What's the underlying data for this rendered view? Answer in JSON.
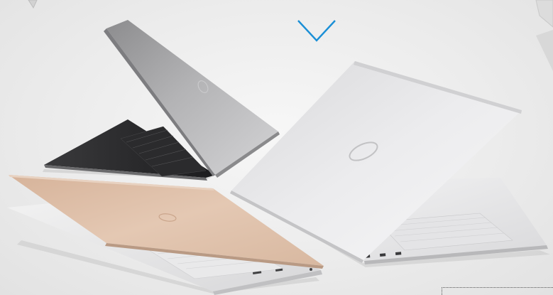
{
  "page": {
    "top_text": "",
    "scroll_icon": "chevron-down-icon",
    "accent_color": "#1a8fd6"
  },
  "products": [
    {
      "name": "",
      "finish_color": "#9a9a9c"
    },
    {
      "name": "",
      "finish_color": "#e6e6e8"
    },
    {
      "name": "",
      "finish_color": "#dcbfa9"
    }
  ]
}
